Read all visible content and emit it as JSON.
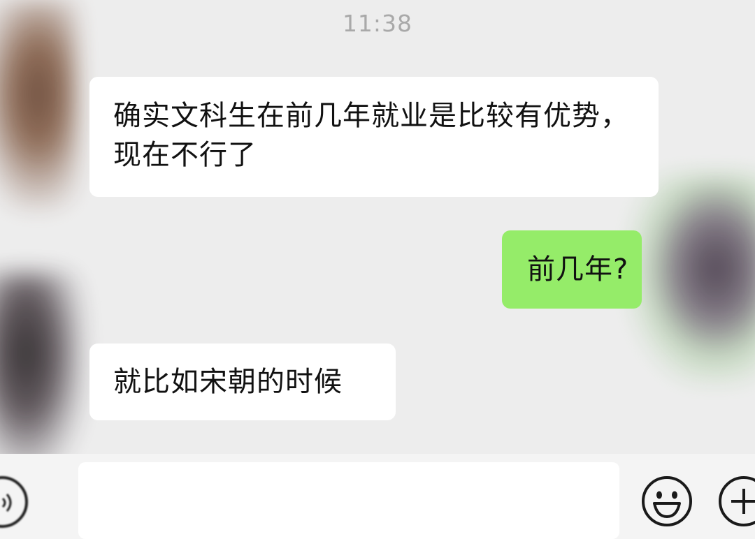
{
  "status": {
    "time": "11:38"
  },
  "messages": [
    {
      "sender": "contact",
      "text": "确实文科生在前几年就业是比较有优势，现在不行了"
    },
    {
      "sender": "me",
      "text": "前几年?"
    },
    {
      "sender": "contact",
      "text": "就比如宋朝的时候"
    }
  ],
  "colors": {
    "background": "#ededed",
    "incoming_bubble": "#ffffff",
    "outgoing_bubble": "#95ec69",
    "timestamp": "#a9a9a9"
  },
  "icons": {
    "voice": "voice-icon",
    "emoji": "emoji-icon",
    "plus": "plus-icon"
  }
}
